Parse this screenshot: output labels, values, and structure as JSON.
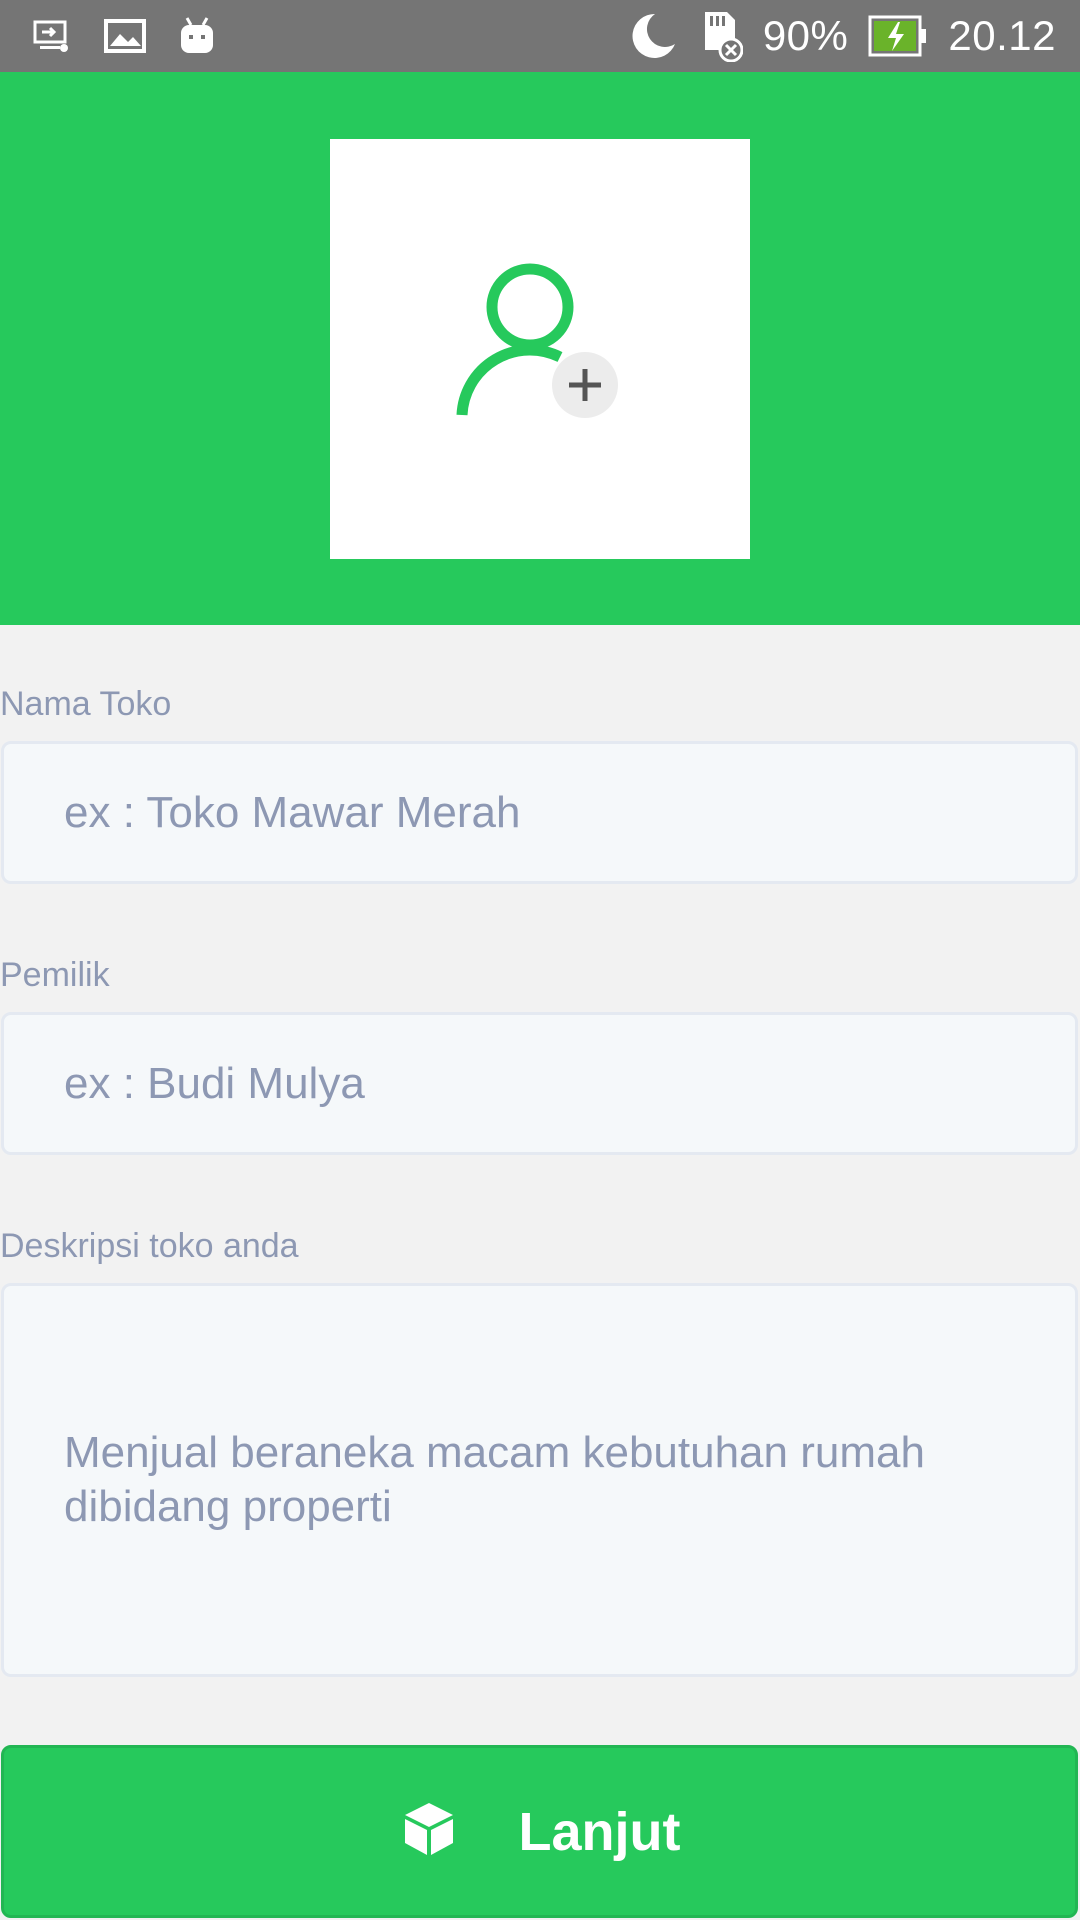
{
  "status_bar": {
    "left_icons": [
      "screen-cast-icon",
      "gallery-icon",
      "android-debug-icon"
    ],
    "right_icons": [
      "moon-icon",
      "sd-card-error-icon",
      "battery-charging-icon"
    ],
    "battery_percent": "90%",
    "time": "20.12"
  },
  "header": {
    "background_color": "#26c95c",
    "avatar_icon": "add-user-icon"
  },
  "form": {
    "store_name": {
      "label": "Nama Toko",
      "placeholder": "ex : Toko Mawar Merah"
    },
    "owner": {
      "label": "Pemilik",
      "placeholder": "ex : Budi Mulya"
    },
    "description": {
      "label": "Deskripsi toko anda",
      "placeholder": "Menjual beraneka macam kebutuhan rumah dibidang properti"
    }
  },
  "next_button": {
    "label": "Lanjut",
    "icon": "cube-icon",
    "color": "#26c95c"
  },
  "colors": {
    "accent": "#26c95c",
    "status_bar": "#757575",
    "label_text": "#8d98b3",
    "field_bg": "#f5f8fa"
  }
}
